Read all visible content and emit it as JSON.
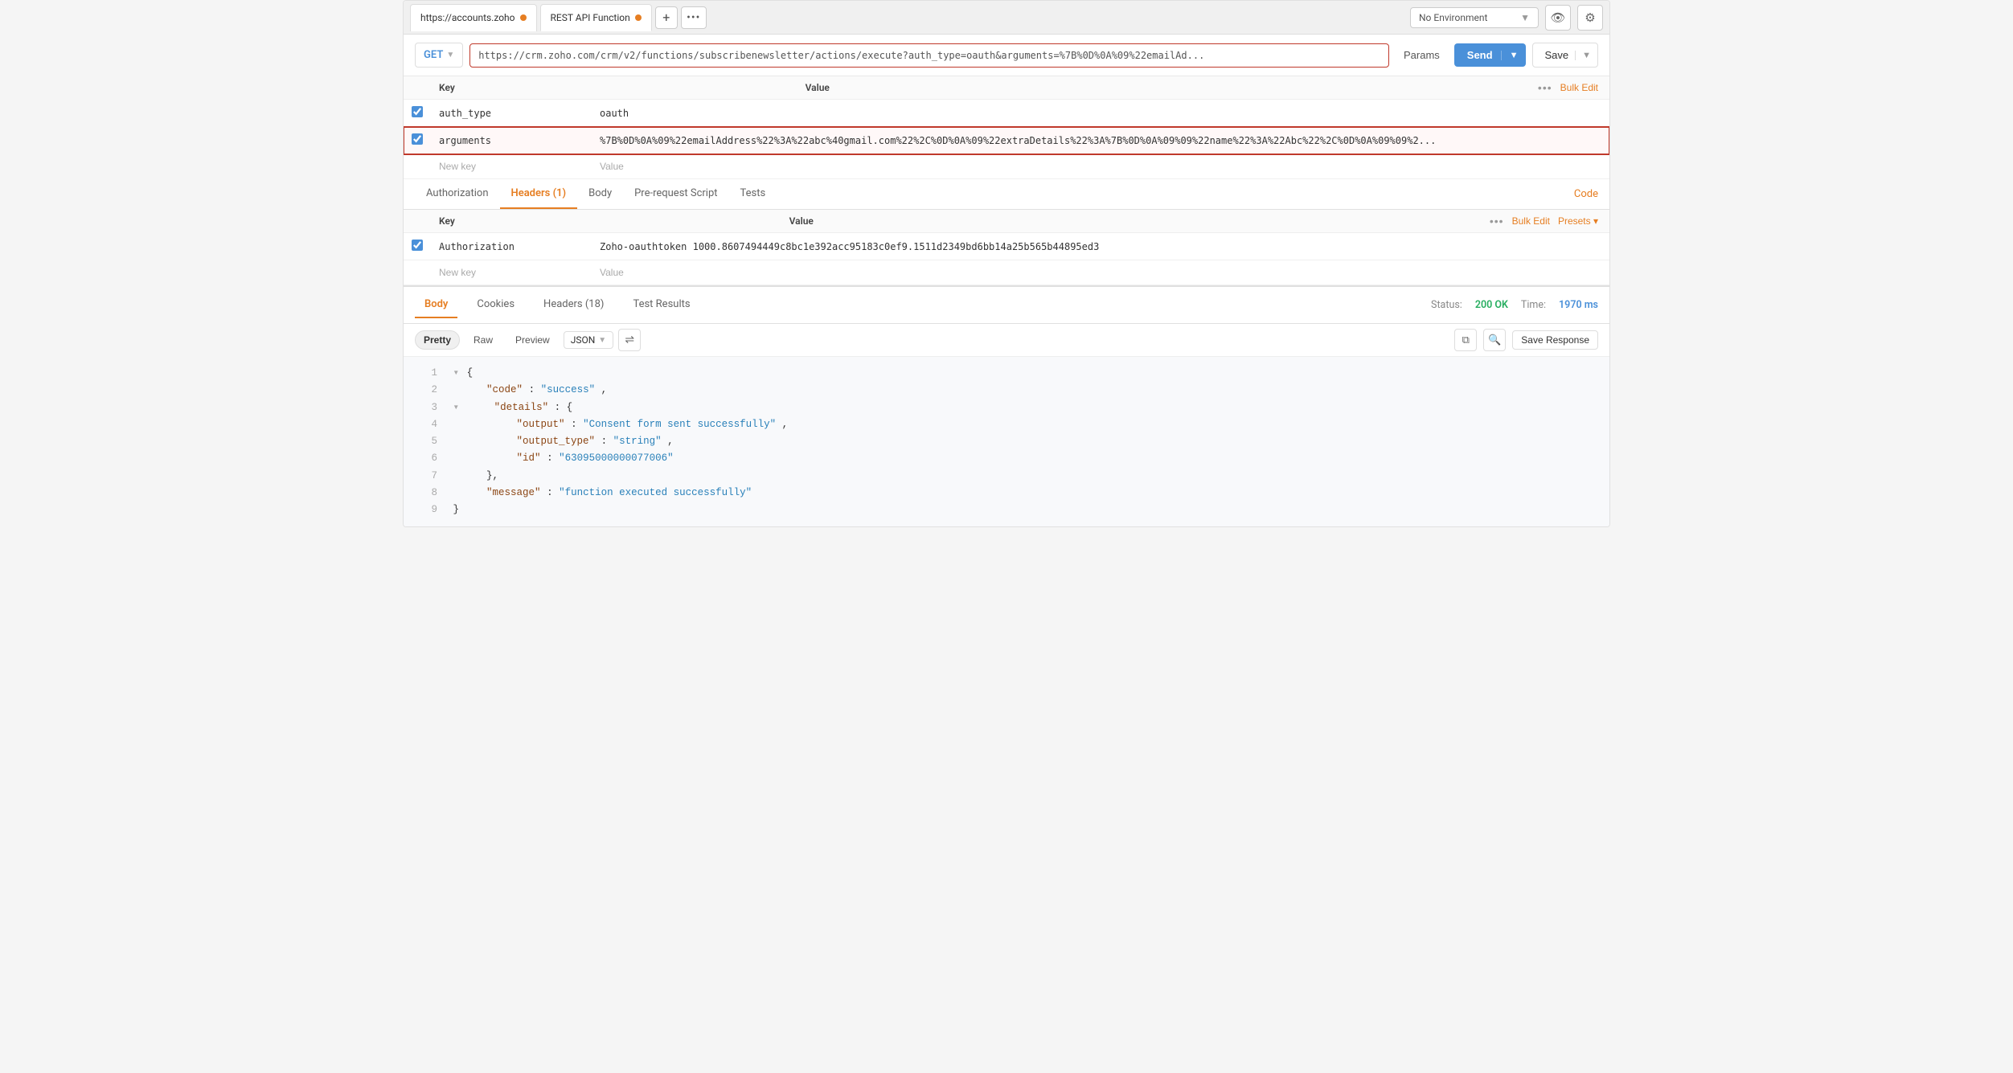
{
  "tabs": [
    {
      "label": "https://accounts.zoho",
      "dot_color": "#e67e22",
      "active": false
    },
    {
      "label": "REST API Function",
      "dot_color": "#e67e22",
      "active": true
    }
  ],
  "tab_add_label": "+",
  "tab_more_label": "•••",
  "env_dropdown": {
    "label": "No Environment",
    "icon": "chevron-down"
  },
  "request": {
    "method": "GET",
    "url": "https://crm.zoho.com/crm/v2/functions/subscribenewsletter/actions/execute?auth_type=oauth&arguments=%7B%0D%0A%09%22emailAd...",
    "params_label": "Params",
    "send_label": "Send",
    "save_label": "Save"
  },
  "params_section": {
    "columns": [
      "Key",
      "Value"
    ],
    "bulk_edit_label": "Bulk Edit",
    "rows": [
      {
        "checked": true,
        "key": "auth_type",
        "value": "oauth",
        "highlighted": false
      },
      {
        "checked": true,
        "key": "arguments",
        "value": "%7B%0D%0A%09%22emailAddress%22%3A%22abc%40gmail.com%22%2C%0D%0A%09%22extraDetails%22%3A%7B%0D%0A%09%09%22name%22%3A%22Abc%22%2C%0D%0A%09%09%2...",
        "highlighted": true
      }
    ],
    "new_key_placeholder": "New key",
    "new_value_placeholder": "Value"
  },
  "request_tabs": [
    {
      "label": "Authorization",
      "active": false
    },
    {
      "label": "Headers (1)",
      "active": true
    },
    {
      "label": "Body",
      "active": false
    },
    {
      "label": "Pre-request Script",
      "active": false
    },
    {
      "label": "Tests",
      "active": false
    }
  ],
  "code_label": "Code",
  "headers_section": {
    "columns": [
      "Key",
      "Value"
    ],
    "bulk_edit_label": "Bulk Edit",
    "presets_label": "Presets ▾",
    "rows": [
      {
        "checked": true,
        "key": "Authorization",
        "value": "Zoho-oauthtoken 1000.8607494449c8bc1e392acc95183c0ef9.1511d2349bd6bb14a25b565b44895ed3"
      }
    ],
    "new_key_placeholder": "New key",
    "new_value_placeholder": "Value"
  },
  "response_tabs": [
    {
      "label": "Body",
      "active": true
    },
    {
      "label": "Cookies",
      "active": false
    },
    {
      "label": "Headers (18)",
      "active": false
    },
    {
      "label": "Test Results",
      "active": false
    }
  ],
  "status": {
    "label": "Status:",
    "value": "200 OK",
    "time_label": "Time:",
    "time_value": "1970 ms"
  },
  "json_toolbar": {
    "format_buttons": [
      "Pretty",
      "Raw",
      "Preview"
    ],
    "active_format": "Pretty",
    "format_select": "JSON",
    "save_response_label": "Save Response"
  },
  "json_body": {
    "lines": [
      {
        "num": 1,
        "collapsible": true,
        "content": "{",
        "type": "brace"
      },
      {
        "num": 2,
        "collapsible": false,
        "indent": "    ",
        "key": "\"code\"",
        "sep": ": ",
        "val": "\"success\"",
        "val_type": "string",
        "comma": ","
      },
      {
        "num": 3,
        "collapsible": true,
        "indent": "    ",
        "key": "\"details\"",
        "sep": ": ",
        "val": "{",
        "val_type": "brace",
        "comma": ""
      },
      {
        "num": 4,
        "collapsible": false,
        "indent": "        ",
        "key": "\"output\"",
        "sep": ": ",
        "val": "\"Consent form sent successfully\"",
        "val_type": "string",
        "comma": ","
      },
      {
        "num": 5,
        "collapsible": false,
        "indent": "        ",
        "key": "\"output_type\"",
        "sep": ": ",
        "val": "\"string\"",
        "val_type": "string",
        "comma": ","
      },
      {
        "num": 6,
        "collapsible": false,
        "indent": "        ",
        "key": "\"id\"",
        "sep": ": ",
        "val": "\"63095000000077006\"",
        "val_type": "string",
        "comma": ""
      },
      {
        "num": 7,
        "collapsible": false,
        "indent": "    ",
        "key": "}",
        "sep": "",
        "val": "",
        "val_type": "brace",
        "comma": ","
      },
      {
        "num": 8,
        "collapsible": false,
        "indent": "    ",
        "key": "\"message\"",
        "sep": ": ",
        "val": "\"function executed successfully\"",
        "val_type": "string",
        "comma": ""
      },
      {
        "num": 9,
        "collapsible": false,
        "indent": "",
        "key": "}",
        "sep": "",
        "val": "",
        "val_type": "brace",
        "comma": ""
      }
    ]
  }
}
